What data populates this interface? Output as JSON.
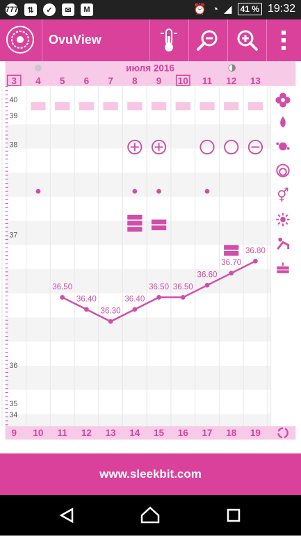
{
  "status": {
    "time": "19:32",
    "battery": "41 %",
    "notif_icons": [
      "777",
      "usb",
      "check",
      "mail",
      "gmail"
    ]
  },
  "app": {
    "title": "OvuView"
  },
  "toolbar": {
    "thermometer": "thermometer-icon",
    "zoom_out": "zoom-out-icon",
    "zoom_in": "zoom-in-icon",
    "menu": "more-vert-icon"
  },
  "header": {
    "month": "июля 2016"
  },
  "days_top": [
    "3",
    "4",
    "5",
    "6",
    "7",
    "8",
    "9",
    "10",
    "11",
    "12",
    "13"
  ],
  "days_bottom": [
    "9",
    "10",
    "11",
    "12",
    "13",
    "14",
    "15",
    "16",
    "17",
    "18",
    "19"
  ],
  "current_day_top": "10",
  "today_top": "3",
  "y_axis": [
    "40",
    "39",
    "38",
    "37",
    "36",
    "35",
    "34"
  ],
  "side_icons": [
    "flower-icon",
    "drop-icon",
    "splat-icon",
    "spiral-icon",
    "gender-icon",
    "sun-icon",
    "intercourse-icon",
    "cake-icon",
    "cycle-refresh-icon"
  ],
  "colors": {
    "accent": "#d9419b",
    "light": "#f7c6e4",
    "mark": "#d04ea9"
  },
  "chart_data": {
    "type": "line",
    "categories": [
      "9",
      "10",
      "11",
      "12",
      "13",
      "14",
      "15",
      "16",
      "17",
      "18",
      "19"
    ],
    "series": [
      {
        "values": [
          null,
          null,
          36.5,
          36.4,
          36.3,
          36.4,
          36.5,
          36.5,
          36.6,
          36.7,
          36.8
        ]
      }
    ],
    "data_labels": [
      "",
      "",
      "36.50",
      "36.40",
      "36.30",
      "36.40",
      "36.50",
      "36.50",
      "36.60",
      "36.70",
      "36.80"
    ],
    "row_markers": {
      "plus": [
        "14",
        "15"
      ],
      "circle": [
        "17",
        "18"
      ],
      "minus": [
        "19"
      ],
      "dot": [
        "10",
        "14",
        "15",
        "17"
      ],
      "bleed_large": [
        "14"
      ],
      "bleed_small": [
        "15",
        "18"
      ]
    },
    "y_ticks": [
      "40",
      "39",
      "38",
      "37",
      "36",
      "35",
      "34"
    ],
    "grid": true
  },
  "footer": {
    "url": "www.sleekbit.com"
  }
}
